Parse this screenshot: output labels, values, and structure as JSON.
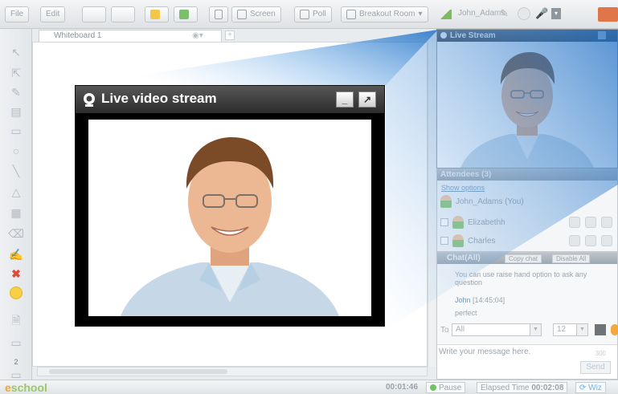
{
  "toolbar": {
    "file": "File",
    "edit": "Edit",
    "screen": "Screen",
    "poll": "Poll",
    "breakout": "Breakout Room",
    "user": "John_Adams"
  },
  "whiteboard": {
    "tab_label": "Whiteboard 1"
  },
  "popup": {
    "title": "Live video stream",
    "minimize": "_",
    "expand": "↗"
  },
  "live_panel": {
    "title": "Live Stream"
  },
  "attendees": {
    "title": "Attendees (3)",
    "show_options": "Show options",
    "items": [
      {
        "name": "John_Adams (You)"
      },
      {
        "name": "Elizabethh"
      },
      {
        "name": "Charles"
      }
    ]
  },
  "chat": {
    "title": "Chat(All)",
    "copy_label": "Copy chat",
    "disable_label": "Disable All",
    "messages": {
      "hint": "You can use raise hand option to ask any question",
      "author": "John",
      "time": "[14:45:04]",
      "text": "perfect"
    },
    "to_label": "To",
    "recipient": "All",
    "font_size": "12",
    "input_placeholder": "Write your message here.",
    "char_count": "300",
    "send_label": "Send"
  },
  "status": {
    "logo_prefix": "e",
    "logo_rest": "school",
    "session_time": "00:01:46",
    "pause_label": "Pause",
    "elapsed_label": "Elapsed Time",
    "elapsed_value": "00:02:08",
    "extra": "Wiz"
  },
  "colors": {
    "accent_blue": "#2f7fd0",
    "logo_orange": "#f2a536",
    "logo_green": "#9bc86b"
  }
}
